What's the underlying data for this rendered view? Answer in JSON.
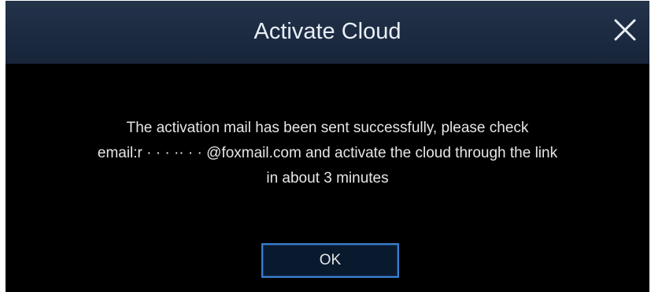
{
  "dialog": {
    "title": "Activate Cloud",
    "close_icon": "close-icon",
    "message": {
      "line1": "The activation mail has been sent successfully, please check",
      "line2": "email:r · · · ·· · · @foxmail.com and activate the cloud through the link",
      "line3": "in about 3 minutes"
    },
    "ok_label": "OK"
  },
  "colors": {
    "titlebar": "#1c2a3c",
    "dialog_body": "#000000",
    "button_border": "#3a7fd0",
    "text": "#e6e6e6"
  }
}
